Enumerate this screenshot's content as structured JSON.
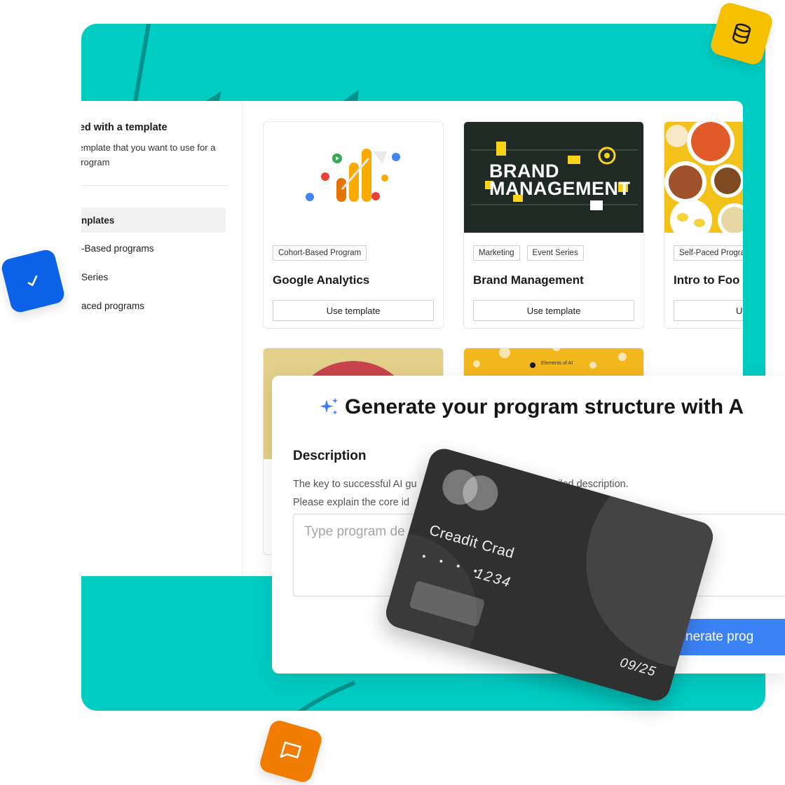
{
  "sidebar": {
    "title": "ted with a template",
    "description": "template that you want to use for a program",
    "items": [
      {
        "label": "nplates"
      },
      {
        "label": "-Based programs"
      },
      {
        "label": "Series"
      },
      {
        "label": "aced programs"
      }
    ]
  },
  "cards": [
    {
      "tags": [
        "Cohort-Based Program"
      ],
      "title": "Google Analytics",
      "button": "Use template"
    },
    {
      "tags": [
        "Marketing",
        "Event Series"
      ],
      "title": "Brand Management",
      "button": "Use template",
      "thumb_text": [
        "BRAND",
        "MANAGEMENT"
      ]
    },
    {
      "tags": [
        "Self-Paced Progra"
      ],
      "title": "Intro to Foo",
      "button": "Use"
    },
    {
      "thumb_text": "Elements of AI"
    }
  ],
  "modal": {
    "title": "Generate your program structure with A",
    "desc_label": "Description",
    "help_line1": "The key to successful AI gu",
    "help_line1_end": "iled description.",
    "help_line2": "Please explain the core id",
    "placeholder": "Type program de",
    "generate_label": "nerate prog"
  },
  "credit_card": {
    "name": "Creadit Crad",
    "dots": "• • • •",
    "number": "1234",
    "expiry": "09/25"
  },
  "colors": {
    "backdrop": "#00CCC2",
    "badge_yellow": "#F5C000",
    "badge_blue": "#0B62E8",
    "badge_orange": "#F27C00",
    "primary_button": "#3B82F6",
    "card_dark": "#303030"
  },
  "icons": {
    "yellow_badge": "database-icon",
    "blue_badge": "check-icon",
    "orange_badge": "chat-bubble-icon",
    "modal_title": "sparkles-icon"
  }
}
